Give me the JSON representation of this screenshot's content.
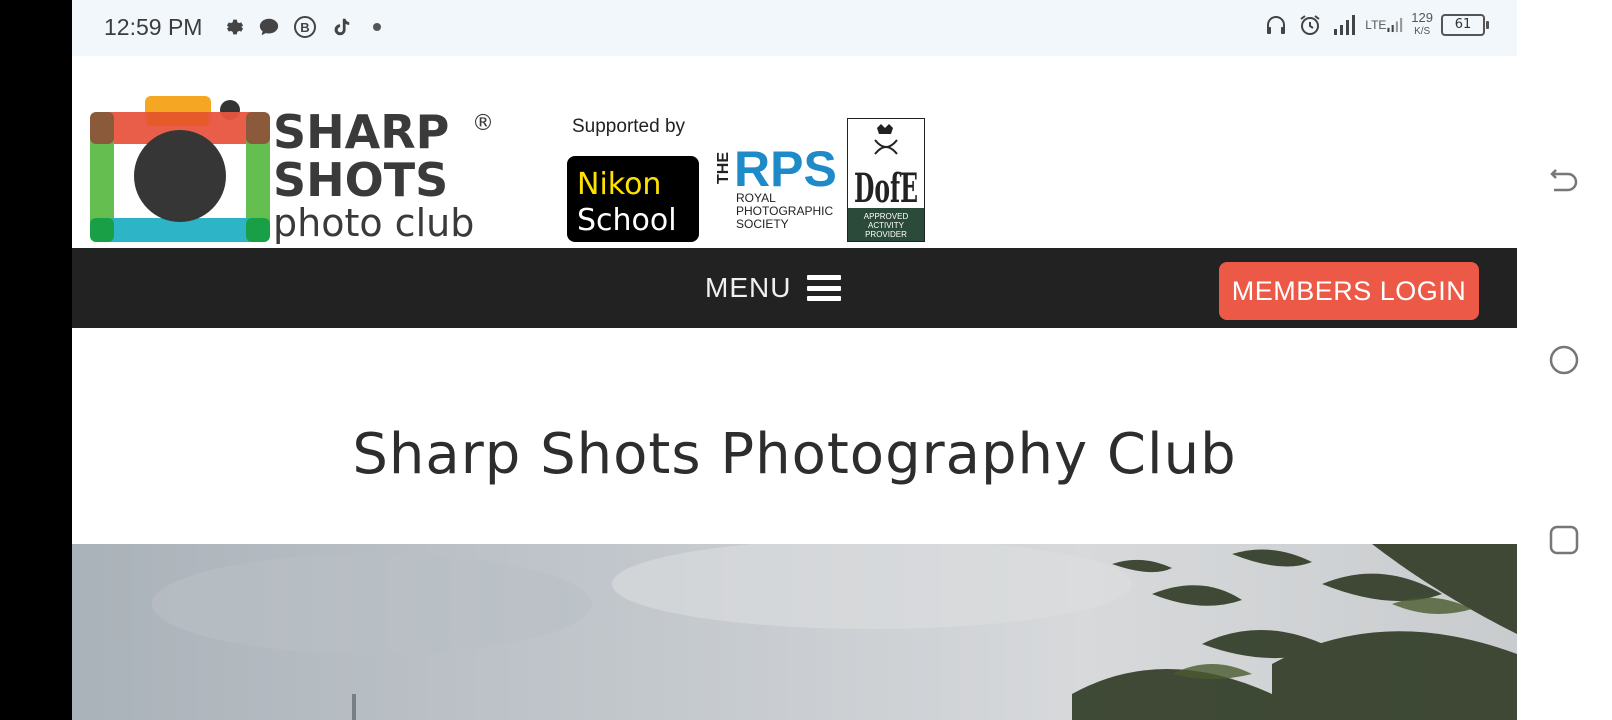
{
  "status_bar": {
    "time": "12:59 PM",
    "network_speed_value": "129",
    "network_speed_unit": "K/S",
    "network_type": "LTE",
    "battery": "61",
    "left_icons": [
      "gear-icon",
      "chat-bubble-icon",
      "b-circle-icon",
      "tiktok-icon",
      "dot-icon"
    ],
    "right_icons": [
      "headphones-icon",
      "alarm-icon",
      "signal-icon",
      "lte-signal-icon",
      "battery-icon"
    ]
  },
  "header": {
    "logo": {
      "line1": "SHARP",
      "line2": "SHOTS",
      "line3": "photo club",
      "registered": "®"
    },
    "supported_by": "Supported by",
    "sponsors": {
      "nikon": {
        "line1": "Nikon",
        "line2": "School"
      },
      "rps": {
        "the": "THE",
        "name": "RPS",
        "line1": "ROYAL",
        "line2": "PHOTOGRAPHIC",
        "line3": "SOCIETY"
      },
      "dofe": {
        "mark": "DofE",
        "line1": "APPROVED",
        "line2": "ACTIVITY",
        "line3": "PROVIDER"
      }
    }
  },
  "nav": {
    "menu_label": "MENU",
    "login_label": "MEMBERS LOGIN"
  },
  "main": {
    "title": "Sharp Shots Photography Club"
  },
  "colors": {
    "accent": "#ec5a47",
    "navbar": "#222222",
    "status_bg": "#f2f7fc"
  }
}
